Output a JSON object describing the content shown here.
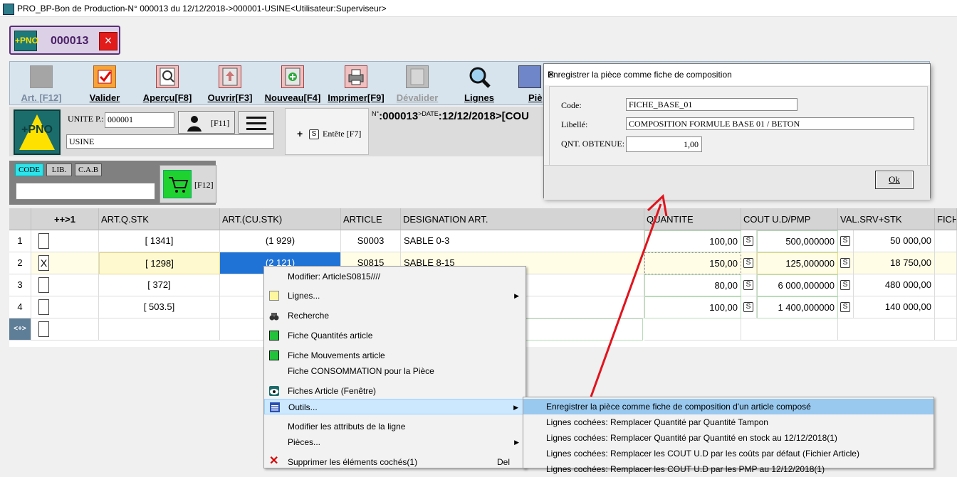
{
  "window": {
    "title": "PRO_BP-Bon de Production-N° 000013 du 12/12/2018->000001-USINE<Utilisateur:Superviseur>"
  },
  "doc_tab": {
    "number": "000013",
    "close": "×",
    "logo_text": "+PNO"
  },
  "toolbar": {
    "items": [
      {
        "label": "Art. [F12]"
      },
      {
        "label": "Valider"
      },
      {
        "label": "Aperçu[F8]"
      },
      {
        "label": "Ouvrir[F3]"
      },
      {
        "label": "Nouveau[F4]"
      },
      {
        "label": "Imprimer[F9]"
      },
      {
        "label": "Dévalider"
      },
      {
        "label": "Lignes"
      },
      {
        "label": "Piè"
      }
    ]
  },
  "header_info": {
    "unite_label": "UNITE P.:",
    "unite_code": "000001",
    "unite_name": "USINE",
    "f11": "[F11]",
    "entete_plus": "+",
    "entete_s": "S",
    "entete_label": "Entête [F7]",
    "doc_line": "N° : 000013 >DATE : 12/12/2018 >[COU",
    "n_label": "N°",
    "n_value": ":000013",
    "date_label": ">DATE",
    "date_value": ":12/12/2018",
    "cou_fragment": ">[COU"
  },
  "search": {
    "tabs": [
      "CODE",
      "LIB.",
      "C.A.B"
    ],
    "value": "",
    "cart_key": "[F12]"
  },
  "grid": {
    "headers": [
      "",
      "++>1",
      "ART.Q.STK",
      "ART.(CU.STK)",
      "ARTICLE",
      "DESIGNATION ART.",
      "QUANTITE",
      "COUT U.D/PMP",
      "VAL.SRV+STK",
      "FICH"
    ],
    "rows": [
      {
        "n": "1",
        "checked": "",
        "qstk": "[ 1341]",
        "custk": "(1 929)",
        "article": "S0003",
        "designation": "SABLE 0-3",
        "quantite": "100,00",
        "cout": "500,000000",
        "val": "50 000,00"
      },
      {
        "n": "2",
        "checked": "X",
        "qstk": "[ 1298]",
        "custk": "(2 121)",
        "article": "S0815",
        "designation": "SABLE 8-15",
        "quantite": "150,00",
        "cout": "125,000000",
        "val": "18 750,00"
      },
      {
        "n": "3",
        "checked": "",
        "qstk": "[ 372]",
        "custk": "",
        "article": "",
        "designation": "",
        "quantite": "80,00",
        "cout": "6 000,000000",
        "val": "480 000,00"
      },
      {
        "n": "4",
        "checked": "",
        "qstk": "[ 503.5]",
        "custk": "",
        "article": "",
        "designation": "",
        "quantite": "100,00",
        "cout": "1 400,000000",
        "val": "140 000,00"
      }
    ],
    "new_row_marker": "<+>",
    "s_label": "S"
  },
  "context_menu": {
    "items": [
      {
        "label": "Modifier: ArticleS0815////",
        "icon": "none"
      },
      {
        "label": "Lignes...",
        "icon": "lines-icon",
        "submenu": true
      },
      {
        "label": "Recherche",
        "icon": "binoculars-icon"
      },
      {
        "label": "Fiche Quantités article",
        "icon": "green-sheet-icon"
      },
      {
        "label": "Fiche Mouvements article",
        "icon": "green-sheet-icon"
      },
      {
        "label": "Fiche CONSOMMATION pour la Pièce",
        "icon": "none"
      },
      {
        "label": "Fiches Article (Fenêtre)",
        "icon": "eye-icon"
      },
      {
        "label": "Outils...",
        "icon": "tools-icon",
        "submenu": true
      },
      {
        "label": "Modifier les attributs de la ligne",
        "icon": "none"
      },
      {
        "label": "Pièces...",
        "icon": "none",
        "submenu": true
      },
      {
        "label": "Supprimer les éléments cochés(1)",
        "icon": "delete-icon",
        "shortcut": "Del"
      }
    ]
  },
  "submenu": {
    "items": [
      "Enregistrer la pièce comme fiche de composition d'un article composé",
      "Lignes cochées: Remplacer Quantité par Quantité Tampon",
      "Lignes cochées: Remplacer Quantité par Quantité en stock au 12/12/2018(1)",
      "Lignes cochées: Remplacer les COUT U.D par les coûts par défaut (Fichier Article)",
      "Lignes cochées: Remplacer les COUT U.D par les PMP au 12/12/2018(1)"
    ]
  },
  "dialog": {
    "title": "Enregistrer la pièce comme fiche de composition",
    "close": "✕",
    "code_label": "Code:",
    "code_value": "FICHE_BASE_01",
    "libelle_label": "Libellé:",
    "libelle_value": "COMPOSITION FORMULE BASE 01 / BETON",
    "qnt_label": "QNT. OBTENUE:",
    "qnt_value": "1,00",
    "ok_label": "Ok"
  },
  "annotation": {
    "arrow_color": "#e0141e"
  }
}
